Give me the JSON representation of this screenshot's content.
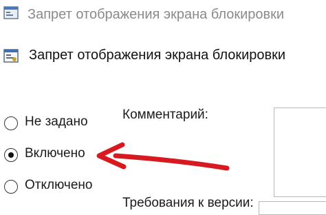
{
  "window": {
    "title": "Запрет отображения экрана блокировки",
    "icon": "policy-icon"
  },
  "header": {
    "title": "Запрет отображения экрана блокировки",
    "icon": "policy-settings-icon"
  },
  "options": {
    "not_configured": "Не задано",
    "enabled": "Включено",
    "disabled": "Отключено",
    "selected": "enabled"
  },
  "comment": {
    "label": "Комментарий:",
    "value": ""
  },
  "requirements": {
    "label": "Требования к версии:"
  },
  "colors": {
    "annotation_arrow": "#d71920"
  }
}
